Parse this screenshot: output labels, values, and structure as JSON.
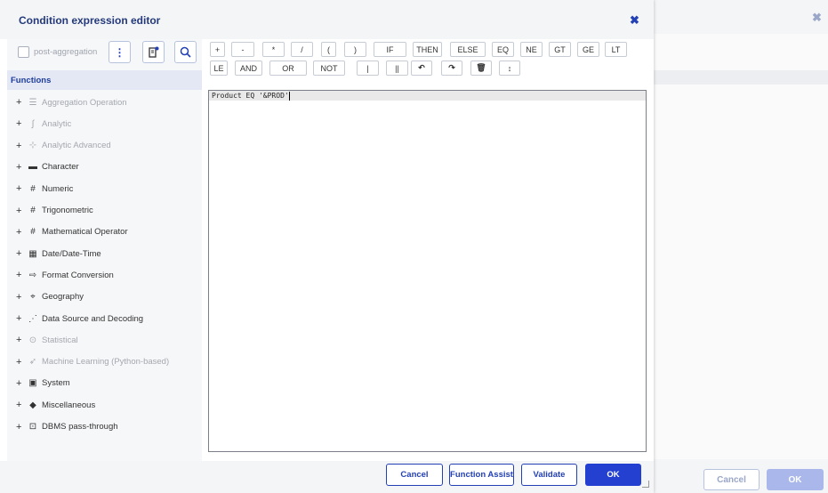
{
  "dialog": {
    "title": "Condition expression editor",
    "close_glyph": "✖"
  },
  "toolbar": {
    "post_aggregation_label": "post-aggregation",
    "post_aggregation_checked": false,
    "menu_icon": "vertical-dots-icon",
    "notes_icon": "document-settings-icon",
    "search_icon": "search-icon"
  },
  "functions": {
    "header": "Functions",
    "items": [
      {
        "label": "Aggregation Operation",
        "icon": "☰",
        "icon_name": "aggregation-icon",
        "enabled": false
      },
      {
        "label": "Analytic",
        "icon": "∫",
        "icon_name": "analytic-icon",
        "enabled": false
      },
      {
        "label": "Analytic Advanced",
        "icon": "⊹",
        "icon_name": "analytic-advanced-icon",
        "enabled": false
      },
      {
        "label": "Character",
        "icon": "▬",
        "icon_name": "character-icon",
        "enabled": true
      },
      {
        "label": "Numeric",
        "icon": "#",
        "icon_name": "numeric-icon",
        "enabled": true
      },
      {
        "label": "Trigonometric",
        "icon": "#",
        "icon_name": "trigonometric-icon",
        "enabled": true
      },
      {
        "label": "Mathematical Operator",
        "icon": "#",
        "icon_name": "math-operator-icon",
        "enabled": true
      },
      {
        "label": "Date/Date-Time",
        "icon": "▦",
        "icon_name": "calendar-icon",
        "enabled": true
      },
      {
        "label": "Format Conversion",
        "icon": "⇨",
        "icon_name": "format-conversion-icon",
        "enabled": true
      },
      {
        "label": "Geography",
        "icon": "⌖",
        "icon_name": "geography-pin-icon",
        "enabled": true
      },
      {
        "label": "Data Source and Decoding",
        "icon": "⋰",
        "icon_name": "data-source-icon",
        "enabled": true
      },
      {
        "label": "Statistical",
        "icon": "⊙",
        "icon_name": "statistical-icon",
        "enabled": false
      },
      {
        "label": "Machine Learning (Python-based)",
        "icon": "➶",
        "icon_name": "machine-learning-icon",
        "enabled": false
      },
      {
        "label": "System",
        "icon": "▣",
        "icon_name": "system-icon",
        "enabled": true
      },
      {
        "label": "Miscellaneous",
        "icon": "◆",
        "icon_name": "miscellaneous-icon",
        "enabled": true
      },
      {
        "label": "DBMS pass-through",
        "icon": "⊡",
        "icon_name": "dbms-pass-through-icon",
        "enabled": true
      }
    ]
  },
  "operators": {
    "row1": [
      "+",
      "-",
      "*",
      "/",
      "(",
      ")",
      "IF",
      "THEN",
      "ELSE",
      "EQ",
      "NE",
      "GT",
      "GE",
      "LT"
    ],
    "row2_text": [
      "LE",
      "AND",
      "OR",
      "NOT",
      "|",
      "||"
    ],
    "row2_icons": [
      {
        "glyph": "↶",
        "name": "undo-icon"
      },
      {
        "glyph": "↷",
        "name": "redo-icon"
      },
      {
        "glyph": "🗑",
        "name": "trash-icon"
      },
      {
        "glyph": "↕",
        "name": "text-cursor-icon"
      }
    ]
  },
  "editor": {
    "expression": "Product EQ '&PROD'"
  },
  "footer": {
    "cancel": "Cancel",
    "function_assist": "Function Assist",
    "validate": "Validate",
    "ok": "OK"
  },
  "background_dialog": {
    "close_glyph": "✖",
    "cancel": "Cancel",
    "ok": "OK"
  }
}
